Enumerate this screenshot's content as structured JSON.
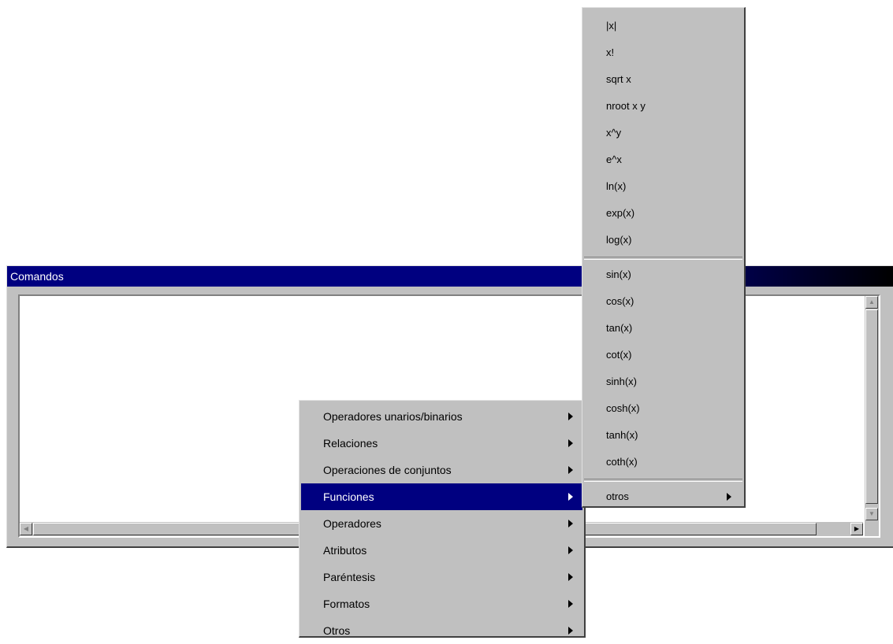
{
  "window": {
    "title": "Comandos"
  },
  "context_menu": {
    "items": [
      {
        "label": "Operadores unarios/binarios",
        "has_submenu": true,
        "active": false
      },
      {
        "label": "Relaciones",
        "has_submenu": true,
        "active": false
      },
      {
        "label": "Operaciones de conjuntos",
        "has_submenu": true,
        "active": false
      },
      {
        "label": "Funciones",
        "has_submenu": true,
        "active": true
      },
      {
        "label": "Operadores",
        "has_submenu": true,
        "active": false
      },
      {
        "label": "Atributos",
        "has_submenu": true,
        "active": false
      },
      {
        "label": "Paréntesis",
        "has_submenu": true,
        "active": false
      },
      {
        "label": "Formatos",
        "has_submenu": true,
        "active": false
      },
      {
        "label": "Otros",
        "has_submenu": true,
        "active": false
      }
    ]
  },
  "submenu_funciones": {
    "group1": [
      "|x|",
      "x!",
      "sqrt x",
      "nroot x y",
      "x^y",
      "e^x",
      "ln(x)",
      "exp(x)",
      "log(x)"
    ],
    "group2": [
      "sin(x)",
      "cos(x)",
      "tan(x)",
      "cot(x)",
      "sinh(x)",
      "cosh(x)",
      "tanh(x)",
      "coth(x)"
    ],
    "group3": [
      {
        "label": "otros",
        "has_submenu": true
      }
    ]
  },
  "colors": {
    "titlebar": "#000080",
    "highlight": "#000080",
    "face": "#c0c0c0"
  }
}
